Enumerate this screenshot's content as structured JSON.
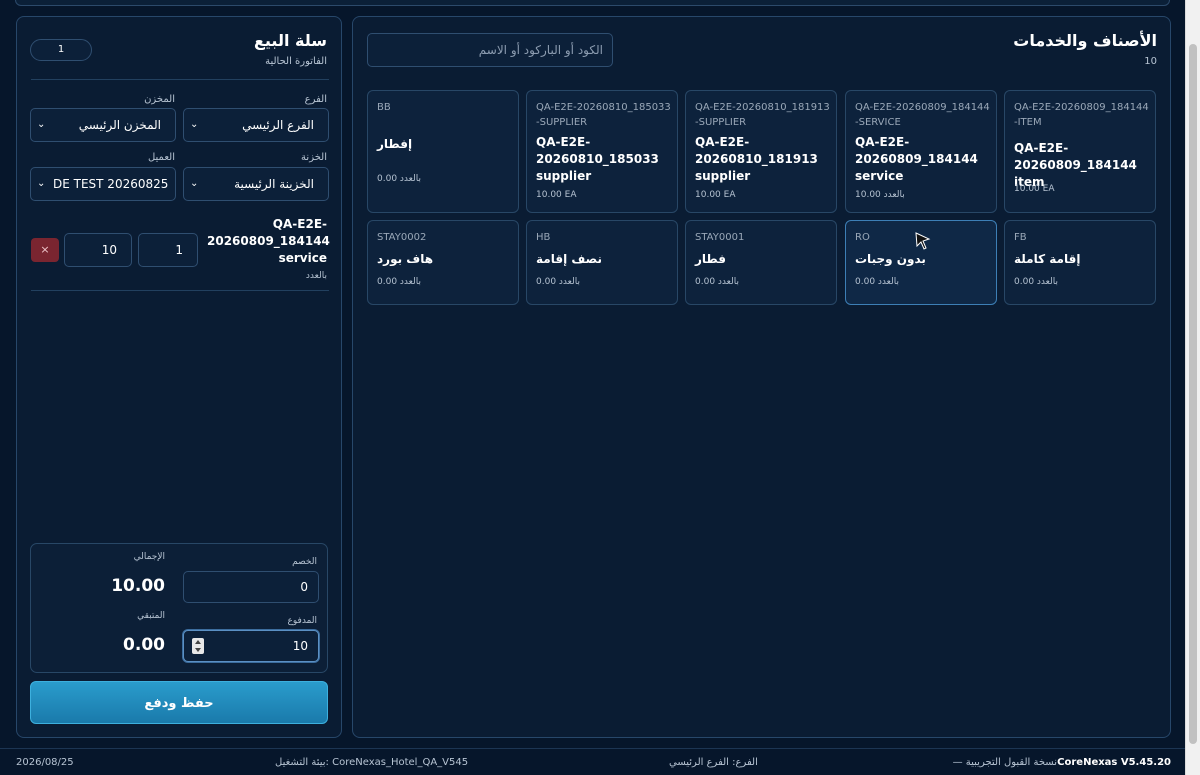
{
  "items_panel": {
    "title": "الأصناف والخدمات",
    "count": "10",
    "search_placeholder": "الكود أو الباركود أو الاسم",
    "items": [
      {
        "code": "QA-E2E-20260809_184144-ITEM",
        "name": "QA-E2E-20260809_184144 item",
        "price": "10.00 EA"
      },
      {
        "code": "QA-E2E-20260809_184144-SERVICE",
        "name": "QA-E2E-20260809_184144 service",
        "price": "10.00 بالعدد"
      },
      {
        "code": "QA-E2E-20260810_181913-SUPPLIER",
        "name": "QA-E2E-20260810_181913 supplier",
        "price": "10.00 EA"
      },
      {
        "code": "QA-E2E-20260810_185033-SUPPLIER",
        "name": "QA-E2E-20260810_185033 supplier",
        "price": "10.00 EA"
      },
      {
        "code": "BB",
        "name": "إفطار",
        "price": "0.00 بالعدد"
      },
      {
        "code": "FB",
        "name": "إقامة كاملة",
        "price": "0.00 بالعدد"
      },
      {
        "code": "RO",
        "name": "بدون وجبات",
        "price": "0.00 بالعدد"
      },
      {
        "code": "STAY0001",
        "name": "فطار",
        "price": "0.00 بالعدد"
      },
      {
        "code": "HB",
        "name": "نصف إقامة",
        "price": "0.00 بالعدد"
      },
      {
        "code": "STAY0002",
        "name": "هاف بورد",
        "price": "0.00 بالعدد"
      }
    ]
  },
  "cart": {
    "title": "سلة البيع",
    "subtitle": "الفاتورة الحالية",
    "invoice_no": "1",
    "branch_label": "الفرع",
    "branch_value": "الفرع الرئيسي",
    "store_label": "المخزن",
    "store_value": "المخزن الرئيسي",
    "treasury_label": "الخزنة",
    "treasury_value": "الخزينة الرئيسية",
    "customer_label": "العميل",
    "customer_value": "DE TEST 20260825",
    "line": {
      "name": "QA-E2E-20260809_184144 service",
      "unit": "بالعدد",
      "qty": "1",
      "price": "10",
      "remove": "×"
    },
    "discount_label": "الخصم",
    "discount_value": "0",
    "total_label": "الإجمالي",
    "total_value": "10.00",
    "paid_label": "المدفوع",
    "paid_value": "10",
    "remaining_label": "المتبقي",
    "remaining_value": "0.00",
    "save_label": "حفظ ودفع"
  },
  "footer": {
    "version": "CoreNexas V5.45.20",
    "edition": "— نسخة القبول التجريبية",
    "branch": "الفرع: الفرع الرئيسي",
    "env": "بيئة التشغيل: CoreNexas_Hotel_QA_V545",
    "date": "2026/08/25"
  },
  "colors": {
    "background": "#06162b",
    "panel": "#0a1c33",
    "accent": "#2a9ccc",
    "danger": "#7a2530"
  }
}
